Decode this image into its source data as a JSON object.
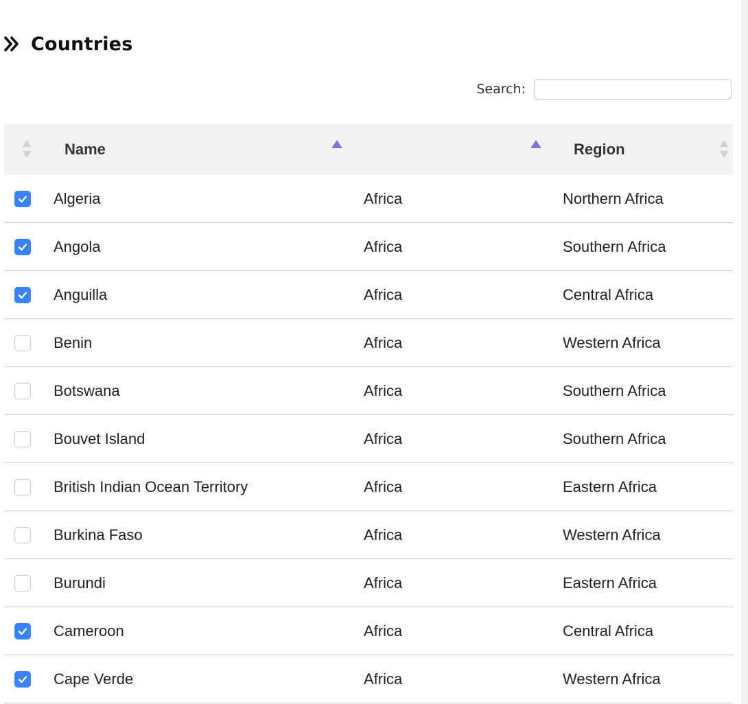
{
  "page": {
    "title": "Countries"
  },
  "search": {
    "label": "Search:",
    "value": "",
    "placeholder": ""
  },
  "table": {
    "headers": {
      "name": "Name",
      "continent": "",
      "region": "Region"
    },
    "sort": {
      "select": "none",
      "name": "asc",
      "continent": "asc",
      "region": "none"
    },
    "rows": [
      {
        "checked": true,
        "name": "Algeria",
        "continent": "Africa",
        "region": "Northern Africa"
      },
      {
        "checked": true,
        "name": "Angola",
        "continent": "Africa",
        "region": "Southern Africa"
      },
      {
        "checked": true,
        "name": "Anguilla",
        "continent": "Africa",
        "region": "Central Africa"
      },
      {
        "checked": false,
        "name": "Benin",
        "continent": "Africa",
        "region": "Western Africa"
      },
      {
        "checked": false,
        "name": "Botswana",
        "continent": "Africa",
        "region": "Southern Africa"
      },
      {
        "checked": false,
        "name": "Bouvet Island",
        "continent": "Africa",
        "region": "Southern Africa"
      },
      {
        "checked": false,
        "name": "British Indian Ocean Territory",
        "continent": "Africa",
        "region": "Eastern Africa"
      },
      {
        "checked": false,
        "name": "Burkina Faso",
        "continent": "Africa",
        "region": "Western Africa"
      },
      {
        "checked": false,
        "name": "Burundi",
        "continent": "Africa",
        "region": "Eastern Africa"
      },
      {
        "checked": true,
        "name": "Cameroon",
        "continent": "Africa",
        "region": "Central Africa"
      },
      {
        "checked": true,
        "name": "Cape Verde",
        "continent": "Africa",
        "region": "Western Africa"
      }
    ]
  },
  "icons": {
    "title": "double-chevron-right-icon",
    "sort_both": "sort-both-icon",
    "sort_asc": "sort-asc-icon",
    "check": "check-icon"
  },
  "colors": {
    "checkbox_checked": "#3b82f6",
    "sort_active": "#7b7bd6",
    "sort_inactive": "#d0d0d0",
    "header_bg": "#f2f2f2"
  }
}
